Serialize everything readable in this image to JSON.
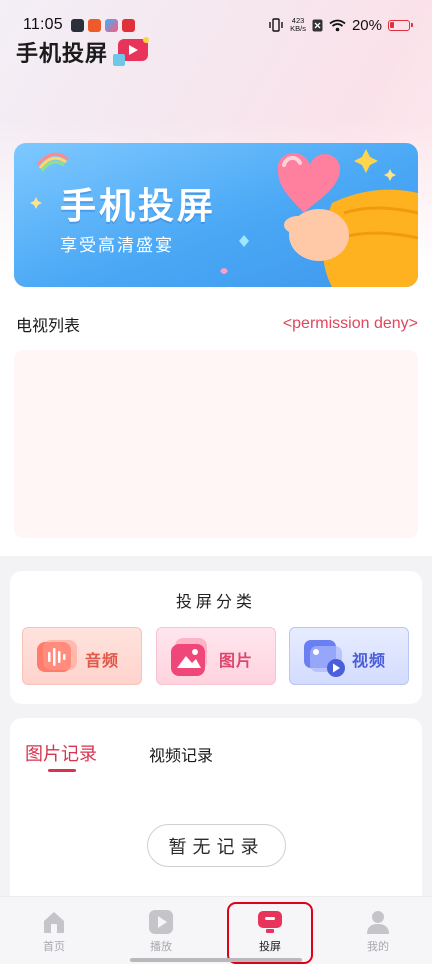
{
  "status_bar": {
    "time": "11:05",
    "net_speed_value": "423",
    "net_speed_unit": "KB/s",
    "battery": "20%"
  },
  "app": {
    "title": "手机投屏"
  },
  "banner": {
    "title": "手机投屏",
    "subtitle": "享受高清盛宴"
  },
  "tv_list": {
    "title": "电视列表",
    "status": "<permission deny>"
  },
  "category": {
    "title": "投屏分类",
    "items": [
      {
        "label": "音频",
        "icon": "audio-icon"
      },
      {
        "label": "图片",
        "icon": "image-icon"
      },
      {
        "label": "视频",
        "icon": "video-icon"
      }
    ]
  },
  "records": {
    "tabs": [
      {
        "label": "图片记录",
        "active": true
      },
      {
        "label": "视频记录",
        "active": false
      }
    ],
    "empty_text": "暂无记录"
  },
  "nav": {
    "items": [
      {
        "label": "首页",
        "icon": "home-icon"
      },
      {
        "label": "播放",
        "icon": "play-icon"
      },
      {
        "label": "投屏",
        "icon": "cast-icon",
        "active": true
      },
      {
        "label": "我的",
        "icon": "user-icon"
      }
    ]
  },
  "colors": {
    "accent": "#d8334f",
    "banner_blue": "#4aa8f5",
    "highlight": "#e0001a"
  }
}
